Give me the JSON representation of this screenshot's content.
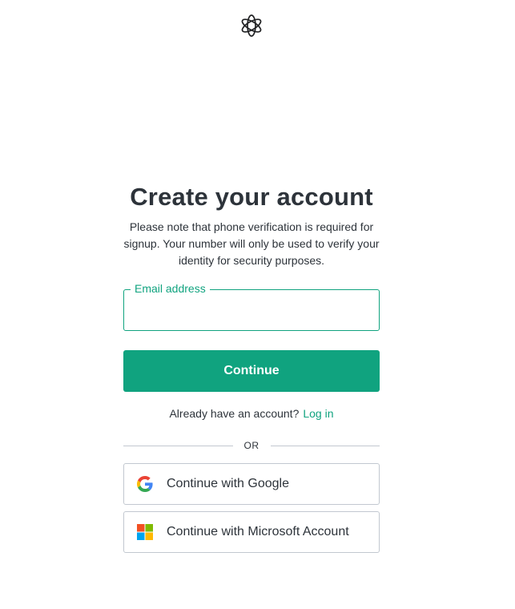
{
  "logo": {
    "icon": "openai-logo-icon"
  },
  "heading": {
    "title": "Create your account"
  },
  "notice": {
    "text": "Please note that phone verification is required for signup. Your number will only be used to verify your identity for security purposes."
  },
  "email": {
    "label": "Email address",
    "value": "",
    "placeholder": ""
  },
  "actions": {
    "continue_label": "Continue"
  },
  "login": {
    "prompt": "Already have an account?",
    "link_label": "Log in"
  },
  "divider": {
    "text": "OR"
  },
  "social": [
    {
      "label": "Continue with Google",
      "icon": "google-icon"
    },
    {
      "label": "Continue with Microsoft Account",
      "icon": "microsoft-icon"
    }
  ],
  "colors": {
    "accent": "#10a37f",
    "text": "#2d333a",
    "border": "#c2c8d0",
    "google_blue": "#4285f4",
    "google_red": "#ea4335",
    "google_yellow": "#fbbc05",
    "google_green": "#34a853",
    "ms_red": "#f25022",
    "ms_green": "#7fba00",
    "ms_blue": "#00a4ef",
    "ms_yellow": "#ffb900"
  }
}
